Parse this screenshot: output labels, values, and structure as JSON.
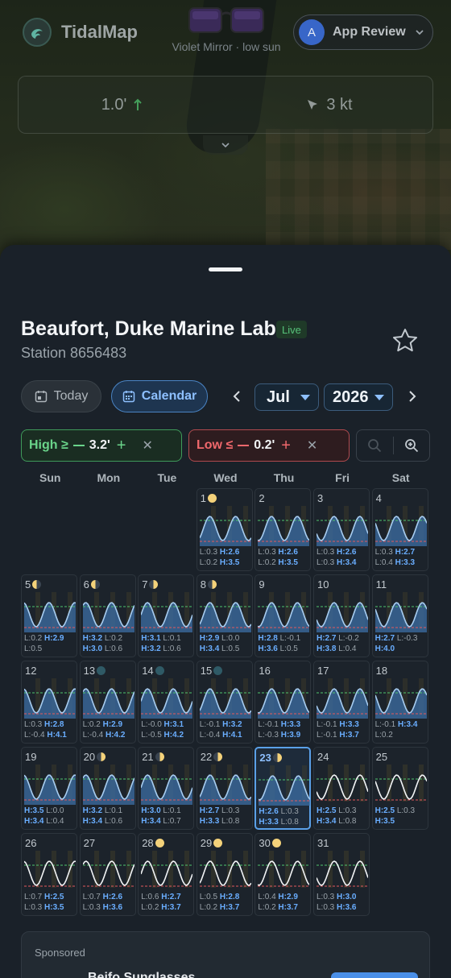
{
  "app": {
    "name": "TidalMap"
  },
  "promo": {
    "caption": "Violet Mirror · low sun"
  },
  "user": {
    "initial": "A",
    "name": "App Review"
  },
  "conditions": {
    "tide": "1.0'",
    "wind": "3 kt"
  },
  "station": {
    "name": "Beaufort, Duke Marine Lab",
    "live": "Live",
    "id": "Station 8656483"
  },
  "controls": {
    "today": "Today",
    "calendar": "Calendar",
    "month": "Jul",
    "year": "2026"
  },
  "filters": {
    "high_label": "High ≥",
    "high_value": "3.2'",
    "low_label": "Low ≤",
    "low_value": "0.2'"
  },
  "weekdays": [
    "Sun",
    "Mon",
    "Tue",
    "Wed",
    "Thu",
    "Fri",
    "Sat"
  ],
  "calendar": {
    "today": 23,
    "days": [
      {
        "d": "1",
        "moon": "full",
        "r1": [
          "L:0.3",
          "H:2.6"
        ],
        "r2": [
          "L:0.2",
          "H:3.5"
        ]
      },
      {
        "d": "2",
        "moon": "",
        "r1": [
          "L:0.3",
          "H:2.6"
        ],
        "r2": [
          "L:0.2",
          "H:3.5"
        ]
      },
      {
        "d": "3",
        "moon": "",
        "r1": [
          "L:0.3",
          "H:2.6"
        ],
        "r2": [
          "L:0.3",
          "H:3.4"
        ]
      },
      {
        "d": "4",
        "moon": "",
        "r1": [
          "L:0.3",
          "H:2.7"
        ],
        "r2": [
          "L:0.4",
          "H:3.3"
        ]
      },
      {
        "d": "5",
        "moon": "waning",
        "r1": [
          "L:0.2",
          "H:2.9"
        ],
        "r2": [
          "L:0.5",
          ""
        ]
      },
      {
        "d": "6",
        "moon": "waning",
        "r1": [
          "H:3.2",
          "L:0.2"
        ],
        "r2": [
          "H:3.0",
          "L:0.6"
        ]
      },
      {
        "d": "7",
        "moon": "quarter",
        "r1": [
          "H:3.1",
          "L:0.1"
        ],
        "r2": [
          "H:3.2",
          "L:0.6"
        ]
      },
      {
        "d": "8",
        "moon": "quarter",
        "r1": [
          "H:2.9",
          "L:0.0"
        ],
        "r2": [
          "H:3.4",
          "L:0.5"
        ]
      },
      {
        "d": "9",
        "moon": "",
        "r1": [
          "H:2.8",
          "L:-0.1"
        ],
        "r2": [
          "H:3.6",
          "L:0.5"
        ]
      },
      {
        "d": "10",
        "moon": "",
        "r1": [
          "H:2.7",
          "L:-0.2"
        ],
        "r2": [
          "H:3.8",
          "L:0.4"
        ]
      },
      {
        "d": "11",
        "moon": "",
        "r1": [
          "H:2.7",
          "L:-0.3"
        ],
        "r2": [
          "H:4.0",
          ""
        ]
      },
      {
        "d": "12",
        "moon": "",
        "r1": [
          "L:0.3",
          "H:2.8"
        ],
        "r2": [
          "L:-0.4",
          "H:4.1"
        ]
      },
      {
        "d": "13",
        "moon": "new",
        "r1": [
          "L:0.2",
          "H:2.9"
        ],
        "r2": [
          "L:-0.4",
          "H:4.2"
        ]
      },
      {
        "d": "14",
        "moon": "new",
        "r1": [
          "L:-0.0",
          "H:3.1"
        ],
        "r2": [
          "L:-0.5",
          "H:4.2"
        ]
      },
      {
        "d": "15",
        "moon": "new",
        "r1": [
          "L:-0.1",
          "H:3.2"
        ],
        "r2": [
          "L:-0.4",
          "H:4.1"
        ]
      },
      {
        "d": "16",
        "moon": "",
        "r1": [
          "L:-0.1",
          "H:3.3"
        ],
        "r2": [
          "L:-0.3",
          "H:3.9"
        ]
      },
      {
        "d": "17",
        "moon": "",
        "r1": [
          "L:-0.1",
          "H:3.3"
        ],
        "r2": [
          "L:-0.1",
          "H:3.7"
        ]
      },
      {
        "d": "18",
        "moon": "",
        "r1": [
          "L:-0.1",
          "H:3.4"
        ],
        "r2": [
          "L:0.2",
          ""
        ]
      },
      {
        "d": "19",
        "moon": "",
        "r1": [
          "H:3.5",
          "L:0.0"
        ],
        "r2": [
          "H:3.4",
          "L:0.4"
        ]
      },
      {
        "d": "20",
        "moon": "waxing",
        "r1": [
          "H:3.2",
          "L:0.1"
        ],
        "r2": [
          "H:3.4",
          "L:0.6"
        ]
      },
      {
        "d": "21",
        "moon": "waxing",
        "r1": [
          "H:3.0",
          "L:0.1"
        ],
        "r2": [
          "H:3.4",
          "L:0.7"
        ]
      },
      {
        "d": "22",
        "moon": "waxing",
        "r1": [
          "H:2.7",
          "L:0.3"
        ],
        "r2": [
          "H:3.3",
          "L:0.8"
        ]
      },
      {
        "d": "23",
        "moon": "waxing",
        "r1": [
          "H:2.6",
          "L:0.3"
        ],
        "r2": [
          "H:3.3",
          "L:0.8"
        ]
      },
      {
        "d": "24",
        "moon": "",
        "r1": [
          "H:2.5",
          "L:0.3"
        ],
        "r2": [
          "H:3.4",
          "L:0.8"
        ]
      },
      {
        "d": "25",
        "moon": "",
        "r1": [
          "H:2.5",
          "L:0.3"
        ],
        "r2": [
          "H:3.5",
          ""
        ]
      },
      {
        "d": "26",
        "moon": "",
        "r1": [
          "L:0.7",
          "H:2.5"
        ],
        "r2": [
          "L:0.3",
          "H:3.5"
        ]
      },
      {
        "d": "27",
        "moon": "",
        "r1": [
          "L:0.7",
          "H:2.6"
        ],
        "r2": [
          "L:0.3",
          "H:3.6"
        ]
      },
      {
        "d": "28",
        "moon": "full",
        "r1": [
          "L:0.6",
          "H:2.7"
        ],
        "r2": [
          "L:0.2",
          "H:3.7"
        ]
      },
      {
        "d": "29",
        "moon": "full",
        "r1": [
          "L:0.5",
          "H:2.8"
        ],
        "r2": [
          "L:0.2",
          "H:3.7"
        ]
      },
      {
        "d": "30",
        "moon": "full",
        "r1": [
          "L:0.4",
          "H:2.9"
        ],
        "r2": [
          "L:0.2",
          "H:3.7"
        ]
      },
      {
        "d": "31",
        "moon": "",
        "r1": [
          "L:0.3",
          "H:3.0"
        ],
        "r2": [
          "L:0.3",
          "H:3.6"
        ]
      }
    ]
  },
  "sponsored": {
    "label": "Sponsored",
    "title": "Bejfo Sunglasses"
  },
  "colors": {
    "accent": "#4a8fe8",
    "high": "#4fc46e",
    "low": "#e25a5e",
    "tide_fill": "#3c6fa6"
  }
}
